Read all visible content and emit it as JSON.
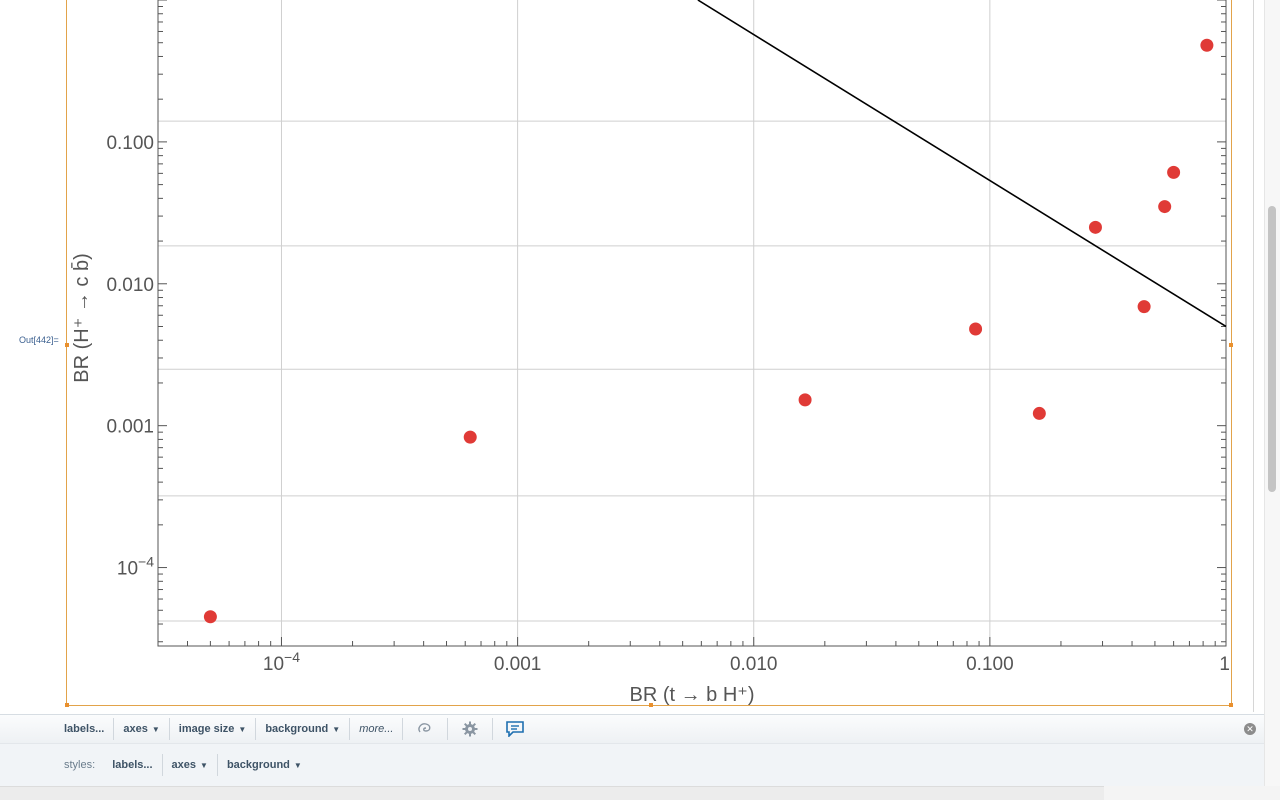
{
  "cell": {
    "out_label": "Out[442]="
  },
  "chart_data": {
    "type": "scatter",
    "xscale": "log",
    "yscale": "log",
    "xlim": [
      3e-05,
      1.0
    ],
    "ylim": [
      2.8e-05,
      1.0
    ],
    "grid": true,
    "xlabel": "BR (t → b H⁺)",
    "ylabel": "BR (H⁺ → c b̄)",
    "xticks": [
      {
        "value": 0.0001,
        "label": "10",
        "exp": "−4"
      },
      {
        "value": 0.001,
        "label": "0.001",
        "exp": ""
      },
      {
        "value": 0.01,
        "label": "0.010",
        "exp": ""
      },
      {
        "value": 0.1,
        "label": "0.100",
        "exp": ""
      },
      {
        "value": 1.0,
        "label": "1",
        "exp": ""
      }
    ],
    "yticks": [
      {
        "value": 0.0001,
        "label": "10",
        "exp": "−4"
      },
      {
        "value": 0.001,
        "label": "0.001",
        "exp": ""
      },
      {
        "value": 0.01,
        "label": "0.010",
        "exp": ""
      },
      {
        "value": 0.1,
        "label": "0.100",
        "exp": ""
      }
    ],
    "points": [
      {
        "x": 5e-05,
        "y": 4.5e-05
      },
      {
        "x": 0.00063,
        "y": 0.00083
      },
      {
        "x": 0.0165,
        "y": 0.00152
      },
      {
        "x": 0.087,
        "y": 0.0048
      },
      {
        "x": 0.162,
        "y": 0.00122
      },
      {
        "x": 0.28,
        "y": 0.025
      },
      {
        "x": 0.45,
        "y": 0.0069
      },
      {
        "x": 0.55,
        "y": 0.035
      },
      {
        "x": 0.6,
        "y": 0.061
      },
      {
        "x": 0.83,
        "y": 0.48
      }
    ],
    "line": {
      "x": [
        0.0058,
        1.0
      ],
      "y": [
        1.0,
        0.005
      ]
    },
    "colors": {
      "points": "#e03a36",
      "line": "#000000",
      "grid": "#cfcfcf",
      "frame": "#555555"
    }
  },
  "toolbar": {
    "labels": "labels...",
    "axes": "axes",
    "image_size": "image size",
    "background": "background",
    "more": "more...",
    "icons": [
      "lasso-icon",
      "gear-icon",
      "comment-icon",
      "close-icon"
    ]
  },
  "styles_bar": {
    "styles_label": "styles:",
    "labels": "labels...",
    "axes": "axes",
    "background": "background"
  }
}
